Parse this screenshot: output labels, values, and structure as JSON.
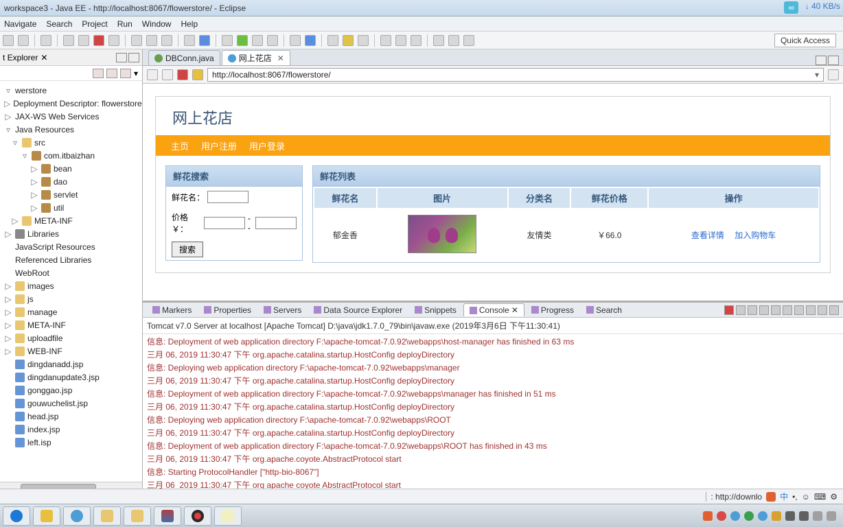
{
  "window": {
    "title": "workspace3 - Java EE - http://localhost:8067/flowerstore/ - Eclipse"
  },
  "net": {
    "speed": "40 KB/s",
    "arrow": "↓"
  },
  "menu": [
    "Navigate",
    "Search",
    "Project",
    "Run",
    "Window",
    "Help"
  ],
  "quickAccess": "Quick Access",
  "explorer": {
    "title": "t Explorer",
    "root": "werstore",
    "nodes": [
      {
        "l": 0,
        "t": "▷",
        "i": "",
        "txt": "Deployment Descriptor: flowerstore"
      },
      {
        "l": 0,
        "t": "▷",
        "i": "",
        "txt": "JAX-WS Web Services"
      },
      {
        "l": 0,
        "t": "▿",
        "i": "",
        "txt": "Java Resources"
      },
      {
        "l": 1,
        "t": "▿",
        "i": "fold",
        "txt": "src"
      },
      {
        "l": 2,
        "t": "▿",
        "i": "pkg",
        "txt": "com.itbaizhan"
      },
      {
        "l": 3,
        "t": "▷",
        "i": "pkg",
        "txt": "bean"
      },
      {
        "l": 3,
        "t": "▷",
        "i": "pkg",
        "txt": "dao"
      },
      {
        "l": 3,
        "t": "▷",
        "i": "pkg",
        "txt": "servlet"
      },
      {
        "l": 3,
        "t": "▷",
        "i": "pkg",
        "txt": "util"
      },
      {
        "l": 1,
        "t": "▷",
        "i": "fold",
        "txt": "META-INF"
      },
      {
        "l": 0,
        "t": "▷",
        "i": "jar",
        "txt": "Libraries"
      },
      {
        "l": 0,
        "t": "",
        "i": "",
        "txt": "JavaScript Resources"
      },
      {
        "l": 0,
        "t": "",
        "i": "",
        "txt": "Referenced Libraries"
      },
      {
        "l": 0,
        "t": "",
        "i": "",
        "txt": "WebRoot"
      },
      {
        "l": 0,
        "t": "▷",
        "i": "fold",
        "txt": "images"
      },
      {
        "l": 0,
        "t": "▷",
        "i": "fold",
        "txt": "js"
      },
      {
        "l": 0,
        "t": "▷",
        "i": "fold",
        "txt": "manage"
      },
      {
        "l": 0,
        "t": "▷",
        "i": "fold",
        "txt": "META-INF"
      },
      {
        "l": 0,
        "t": "▷",
        "i": "fold",
        "txt": "uploadfile"
      },
      {
        "l": 0,
        "t": "▷",
        "i": "fold",
        "txt": "WEB-INF"
      },
      {
        "l": 0,
        "t": "",
        "i": "jsp",
        "txt": "dingdanadd.jsp"
      },
      {
        "l": 0,
        "t": "",
        "i": "jsp",
        "txt": "dingdanupdate3.jsp"
      },
      {
        "l": 0,
        "t": "",
        "i": "jsp",
        "txt": "gonggao.jsp"
      },
      {
        "l": 0,
        "t": "",
        "i": "jsp",
        "txt": "gouwuchelist.jsp"
      },
      {
        "l": 0,
        "t": "",
        "i": "jsp",
        "txt": "head.jsp"
      },
      {
        "l": 0,
        "t": "",
        "i": "jsp",
        "txt": "index.jsp"
      },
      {
        "l": 0,
        "t": "",
        "i": "jsp",
        "txt": "left.isp"
      }
    ]
  },
  "tabs": [
    {
      "label": "DBConn.java",
      "icon": "j",
      "active": false
    },
    {
      "label": "网上花店",
      "icon": "w",
      "active": true
    }
  ],
  "browser": {
    "url": "http://localhost:8067/flowerstore/"
  },
  "site": {
    "title": "网上花店",
    "nav": [
      "主页",
      "用户注册",
      "用户登录"
    ],
    "searchTitle": "鲜花搜索",
    "listTitle": "鲜花列表",
    "searchLabels": {
      "name": "鲜花名：",
      "price": "价格￥：",
      "sep": "--",
      "btn": "搜索"
    },
    "columns": [
      "鲜花名",
      "图片",
      "分类名",
      "鲜花价格",
      "操作"
    ],
    "row": {
      "name": "郁金香",
      "cat": "友情类",
      "price": "￥66.0",
      "view": "查看详情",
      "cart": "加入购物车"
    }
  },
  "bottomTabs": [
    "Markers",
    "Properties",
    "Servers",
    "Data Source Explorer",
    "Snippets",
    "Console",
    "Progress",
    "Search"
  ],
  "consoleTitle": "Tomcat v7.0 Server at localhost [Apache Tomcat] D:\\java\\jdk1.7.0_79\\bin\\javaw.exe (2019年3月6日 下午11:30:41)",
  "console": [
    "信息: Deployment of web application directory F:\\apache-tomcat-7.0.92\\webapps\\host-manager has finished in 63 ms",
    "三月 06, 2019 11:30:47 下午 org.apache.catalina.startup.HostConfig deployDirectory",
    "信息: Deploying web application directory F:\\apache-tomcat-7.0.92\\webapps\\manager",
    "三月 06, 2019 11:30:47 下午 org.apache.catalina.startup.HostConfig deployDirectory",
    "信息: Deployment of web application directory F:\\apache-tomcat-7.0.92\\webapps\\manager has finished in 51 ms",
    "三月 06, 2019 11:30:47 下午 org.apache.catalina.startup.HostConfig deployDirectory",
    "信息: Deploying web application directory F:\\apache-tomcat-7.0.92\\webapps\\ROOT",
    "三月 06, 2019 11:30:47 下午 org.apache.catalina.startup.HostConfig deployDirectory",
    "信息: Deployment of web application directory F:\\apache-tomcat-7.0.92\\webapps\\ROOT has finished in 43 ms",
    "三月 06, 2019 11:30:47 下午 org.apache.coyote.AbstractProtocol start",
    "信息: Starting ProtocolHandler [\"http-bio-8067\"]",
    "三月 06  2019 11:30:47 下午 org apache coyote AbstractProtocol start"
  ],
  "status": {
    "url": "http://downlo",
    "lang": "中"
  }
}
